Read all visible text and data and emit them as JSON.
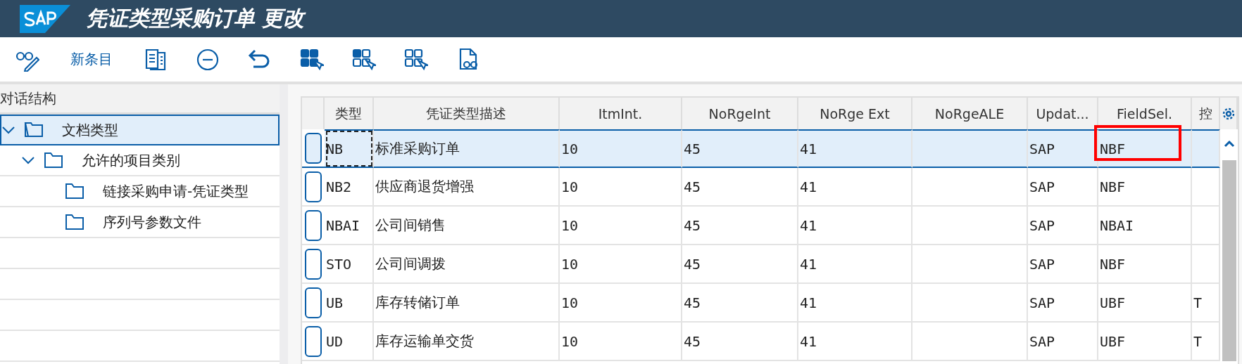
{
  "window": {
    "title": "凭证类型采购订单 更改"
  },
  "toolbar": {
    "new_entries": "新条目"
  },
  "tree": {
    "title": "对话结构",
    "items": [
      {
        "label": "文档类型",
        "selected": true,
        "expanded": true,
        "children": [
          {
            "label": "允许的项目类别",
            "selected": false,
            "expanded": true,
            "children": [
              {
                "label": "链接采购申请-凭证类型",
                "selected": false
              },
              {
                "label": "序列号参数文件",
                "selected": false
              }
            ]
          }
        ]
      }
    ]
  },
  "table": {
    "columns": [
      "类型",
      "凭证类型描述",
      "ItmInt.",
      "NoRgeInt",
      "NoRge Ext",
      "NoRgeALE",
      "Updat...",
      "FieldSel.",
      "控"
    ],
    "rows": [
      {
        "selected": true,
        "cells": [
          "NB",
          "标准采购订单",
          "10",
          "45",
          "41",
          "",
          "SAP",
          "NBF",
          ""
        ]
      },
      {
        "selected": false,
        "cells": [
          "NB2",
          "供应商退货增强",
          "10",
          "45",
          "41",
          "",
          "SAP",
          "NBF",
          ""
        ]
      },
      {
        "selected": false,
        "cells": [
          "NBAI",
          "公司间销售",
          "10",
          "45",
          "41",
          "",
          "SAP",
          "NBAI",
          ""
        ]
      },
      {
        "selected": false,
        "cells": [
          "STO",
          "公司间调拨",
          "10",
          "45",
          "41",
          "",
          "SAP",
          "NBF",
          ""
        ]
      },
      {
        "selected": false,
        "cells": [
          "UB",
          "库存转储订单",
          "10",
          "45",
          "41",
          "",
          "SAP",
          "UBF",
          "T"
        ]
      },
      {
        "selected": false,
        "cells": [
          "UD",
          "库存运输单交货",
          "10",
          "45",
          "41",
          "",
          "SAP",
          "UBF",
          "T"
        ]
      }
    ]
  }
}
